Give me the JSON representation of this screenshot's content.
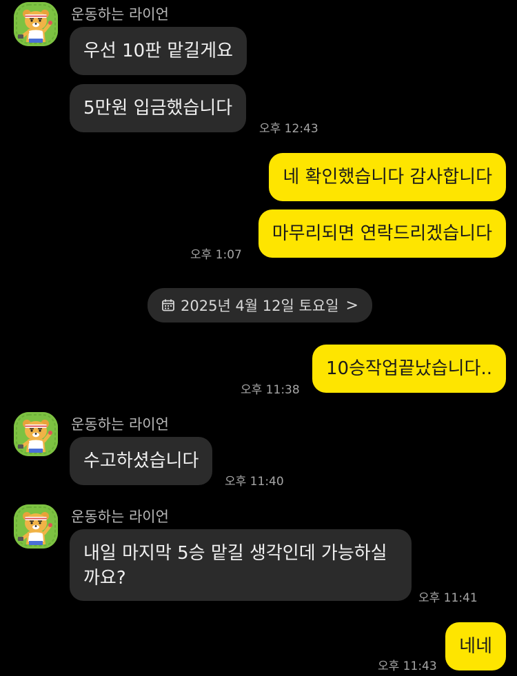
{
  "colors": {
    "background": "#000000",
    "incoming_bubble": "#2b2b2b",
    "outgoing_bubble": "#fee500",
    "avatar_bg": "#7dc242"
  },
  "messages": {
    "g1": {
      "sender": "운동하는 라이언",
      "m1": "우선 10판 맡길게요",
      "m2": "5만원 입금했습니다",
      "time": "오후 12:43"
    },
    "g2": {
      "m1": "네 확인했습니다 감사합니다",
      "m2": "마무리되면 연락드리겠습니다",
      "time": "오후 1:07"
    },
    "date_divider": {
      "label": "2025년 4월 12일 토요일",
      "icon": "calendar-icon",
      "chevron": ">"
    },
    "g3": {
      "m1": "10승작업끝났습니다..",
      "time": "오후 11:38"
    },
    "g4": {
      "sender": "운동하는 라이언",
      "m1": "수고하셨습니다",
      "time": "오후 11:40"
    },
    "g5": {
      "sender": "운동하는 라이언",
      "m1": "내일 마지막 5승 맡길 생각인데 가능하실까요?",
      "time": "오후 11:41"
    },
    "g6": {
      "m1": "네네",
      "time": "오후 11:43"
    }
  }
}
